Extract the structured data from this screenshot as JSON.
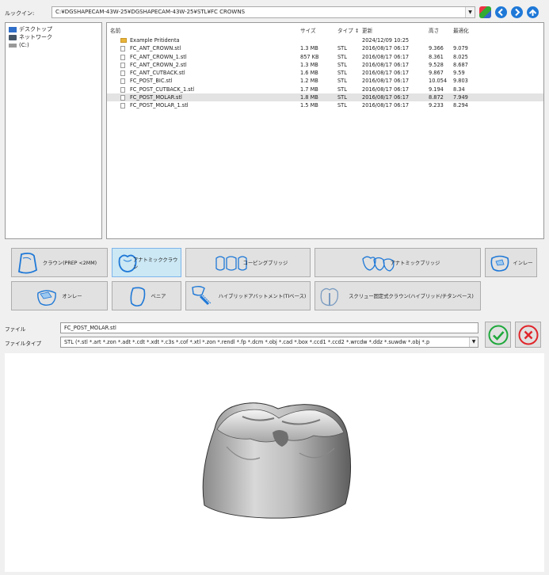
{
  "toolbar": {
    "lookin_label": "ルックイン:",
    "path": "C:¥DGSHAPECAM-43W-25¥DGSHAPECAM-43W-25¥STL¥FC CROWNS"
  },
  "tree": {
    "items": [
      {
        "label": "デスクトップ",
        "icon": "desktop-icon"
      },
      {
        "label": "ネットワーク",
        "icon": "network-icon"
      },
      {
        "label": "(C:)",
        "icon": "drive-icon"
      }
    ]
  },
  "filelist": {
    "headers": {
      "name": "名前",
      "size": "サイズ",
      "type": "タイプ ↕",
      "date": "更新",
      "height": "高さ",
      "change": "最適化"
    },
    "rows": [
      {
        "name": "Example Pritidenta",
        "size": "",
        "type": "",
        "date": "2024/12/09 10:25",
        "height": "",
        "change": "",
        "folder": true
      },
      {
        "name": "FC_ANT_CROWN.stl",
        "size": "1.3 MB",
        "type": "STL",
        "date": "2016/08/17 06:17",
        "height": "9.366",
        "change": "9.079"
      },
      {
        "name": "FC_ANT_CROWN_1.stl",
        "size": "857 KB",
        "type": "STL",
        "date": "2016/08/17 06:17",
        "height": "8.361",
        "change": "8.025"
      },
      {
        "name": "FC_ANT_CROWN_2.stl",
        "size": "1.3 MB",
        "type": "STL",
        "date": "2016/08/17 06:17",
        "height": "9.528",
        "change": "8.687"
      },
      {
        "name": "FC_ANT_CUTBACK.stl",
        "size": "1.6 MB",
        "type": "STL",
        "date": "2016/08/17 06:17",
        "height": "9.867",
        "change": "9.59"
      },
      {
        "name": "FC_POST_BIC.stl",
        "size": "1.2 MB",
        "type": "STL",
        "date": "2016/08/17 06:17",
        "height": "10.054",
        "change": "9.803"
      },
      {
        "name": "FC_POST_CUTBACK_1.stl",
        "size": "1.7 MB",
        "type": "STL",
        "date": "2016/08/17 06:17",
        "height": "9.194",
        "change": "8.34"
      },
      {
        "name": "FC_POST_MOLAR.stl",
        "size": "1.8 MB",
        "type": "STL",
        "date": "2016/08/17 06:17",
        "height": "8.872",
        "change": "7.949",
        "selected": true
      },
      {
        "name": "FC_POST_MOLAR_1.stl",
        "size": "1.5 MB",
        "type": "STL",
        "date": "2016/08/17 06:17",
        "height": "9.233",
        "change": "8.294"
      }
    ]
  },
  "buttons": {
    "crown_prep": "クラウン(PREP <2MM)",
    "anatomic_crown": "アナトミッククラウン",
    "coping_bridge": "コーピングブリッジ",
    "anatomic_bridge": "アナトミックブリッジ",
    "inlay": "インレー",
    "onlay": "オンレー",
    "veneer": "ベニア",
    "hybrid_abutment": "ハイブリッドアバットメント(TIベース)",
    "screw_crown": "スクリュー固定式クラウン(ハイブリッド/チタンベース)"
  },
  "fields": {
    "file_label": "ファイル",
    "file_value": "FC_POST_MOLAR.stl",
    "type_label": "ファイルタイプ",
    "type_value": "STL (*.stl *.art *.zon *.adt *.cdt *.xdt *.c3s *.cof *.xtl *.zon *.rendl *.fp *.dcm *.obj *.cad *.box *.ccd1 *.ccd2 *.wrcdw *.ddz *.suwdw *.obj *.p"
  },
  "colors": {
    "accent": "#1e78d7",
    "ok_green": "#1fa83c",
    "cancel_red": "#e0262b",
    "selected_row": "#e3e3e3",
    "active_button": "#cce8f4"
  }
}
